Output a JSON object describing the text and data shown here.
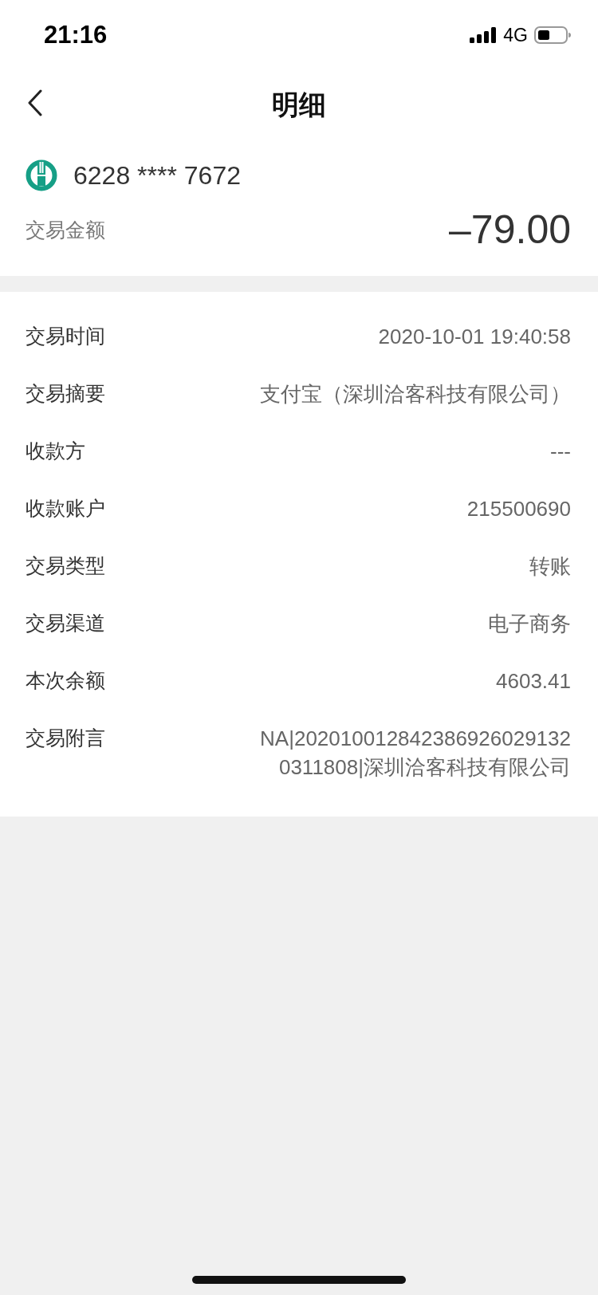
{
  "status_bar": {
    "time": "21:16",
    "network": "4G"
  },
  "nav": {
    "title": "明细"
  },
  "card": {
    "number": "6228 **** 7672",
    "amount_label": "交易金额",
    "amount": "–79.00"
  },
  "details": [
    {
      "label": "交易时间",
      "value": "2020-10-01 19:40:58"
    },
    {
      "label": "交易摘要",
      "value": "支付宝（深圳洽客科技有限公司）"
    },
    {
      "label": "收款方",
      "value": "---"
    },
    {
      "label": "收款账户",
      "value": "215500690"
    },
    {
      "label": "交易类型",
      "value": "转账"
    },
    {
      "label": "交易渠道",
      "value": "电子商务"
    },
    {
      "label": "本次余额",
      "value": "4603.41"
    },
    {
      "label": "交易附言",
      "value": "NA|2020100128423869260291320311808|深圳洽客科技有限公司"
    }
  ]
}
